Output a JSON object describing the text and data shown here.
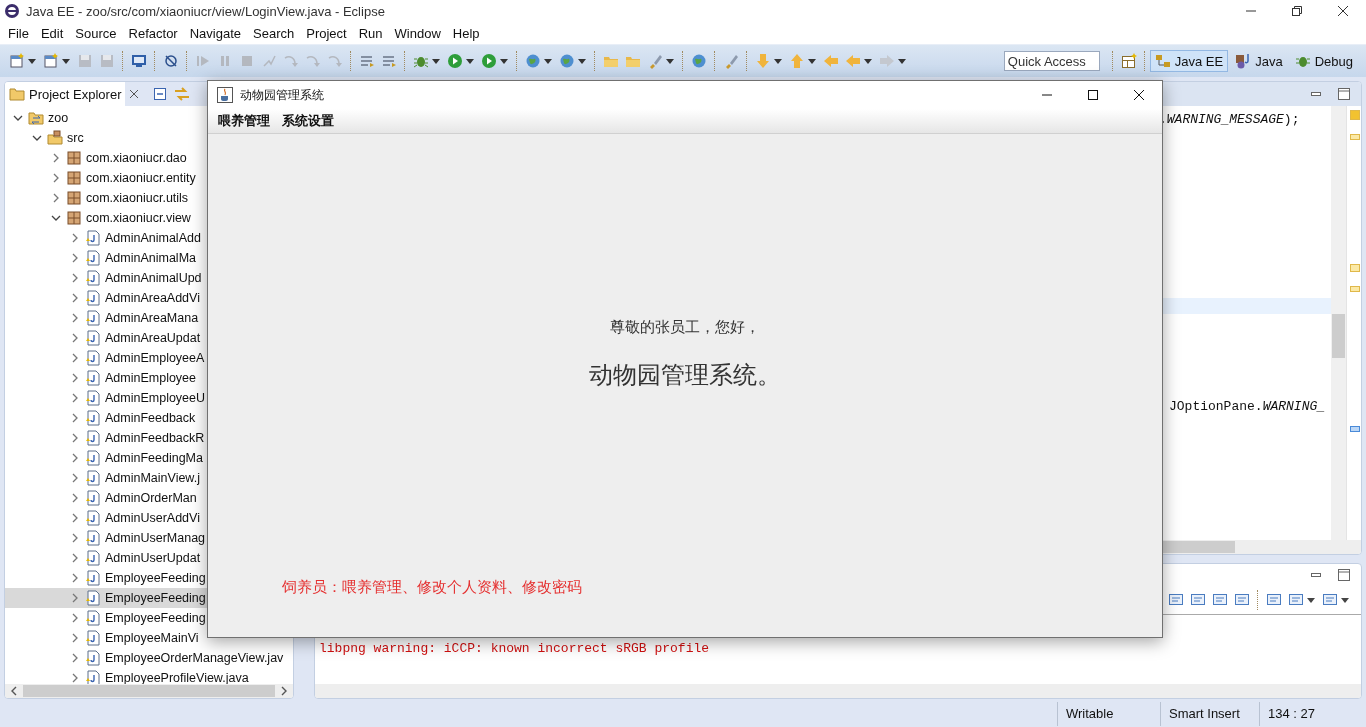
{
  "window": {
    "title": "Java EE - zoo/src/com/xiaoniucr/view/LoginView.java - Eclipse"
  },
  "menu": [
    "File",
    "Edit",
    "Source",
    "Refactor",
    "Navigate",
    "Search",
    "Project",
    "Run",
    "Window",
    "Help"
  ],
  "quick_access": {
    "placeholder": "Quick Access"
  },
  "perspectives": [
    {
      "label": "Java EE",
      "selected": true
    },
    {
      "label": "Java",
      "selected": false
    },
    {
      "label": "Debug",
      "selected": false
    }
  ],
  "project_explorer": {
    "title": "Project Explorer",
    "tree": [
      {
        "label": "zoo",
        "kind": "project",
        "expanded": true,
        "selected": false,
        "children": [
          {
            "label": "src",
            "kind": "source",
            "expanded": true,
            "selected": false,
            "children": [
              {
                "label": "com.xiaoniucr.dao",
                "kind": "package",
                "expanded": false,
                "selected": false
              },
              {
                "label": "com.xiaoniucr.entity",
                "kind": "package",
                "expanded": false,
                "selected": false
              },
              {
                "label": "com.xiaoniucr.utils",
                "kind": "package",
                "expanded": false,
                "selected": false
              },
              {
                "label": "com.xiaoniucr.view",
                "kind": "package",
                "expanded": true,
                "selected": false,
                "children": [
                  {
                    "label": "AdminAnimalAdd",
                    "kind": "file",
                    "expanded": false,
                    "selected": false
                  },
                  {
                    "label": "AdminAnimalMa",
                    "kind": "file",
                    "expanded": false,
                    "selected": false
                  },
                  {
                    "label": "AdminAnimalUpd",
                    "kind": "file",
                    "expanded": false,
                    "selected": false
                  },
                  {
                    "label": "AdminAreaAddVi",
                    "kind": "file",
                    "expanded": false,
                    "selected": false
                  },
                  {
                    "label": "AdminAreaMana",
                    "kind": "file",
                    "expanded": false,
                    "selected": false
                  },
                  {
                    "label": "AdminAreaUpdat",
                    "kind": "file",
                    "expanded": false,
                    "selected": false
                  },
                  {
                    "label": "AdminEmployeeA",
                    "kind": "file",
                    "expanded": false,
                    "selected": false
                  },
                  {
                    "label": "AdminEmployee",
                    "kind": "file",
                    "expanded": false,
                    "selected": false
                  },
                  {
                    "label": "AdminEmployeeU",
                    "kind": "file",
                    "expanded": false,
                    "selected": false
                  },
                  {
                    "label": "AdminFeedback",
                    "kind": "file",
                    "expanded": false,
                    "selected": false
                  },
                  {
                    "label": "AdminFeedbackR",
                    "kind": "file",
                    "expanded": false,
                    "selected": false
                  },
                  {
                    "label": "AdminFeedingMa",
                    "kind": "file",
                    "expanded": false,
                    "selected": false
                  },
                  {
                    "label": "AdminMainView.j",
                    "kind": "file",
                    "expanded": false,
                    "selected": false
                  },
                  {
                    "label": "AdminOrderMan",
                    "kind": "file",
                    "expanded": false,
                    "selected": false
                  },
                  {
                    "label": "AdminUserAddVi",
                    "kind": "file",
                    "expanded": false,
                    "selected": false
                  },
                  {
                    "label": "AdminUserManag",
                    "kind": "file",
                    "expanded": false,
                    "selected": false
                  },
                  {
                    "label": "AdminUserUpdat",
                    "kind": "file",
                    "expanded": false,
                    "selected": false
                  },
                  {
                    "label": "EmployeeFeeding",
                    "kind": "file",
                    "expanded": false,
                    "selected": false
                  },
                  {
                    "label": "EmployeeFeeding",
                    "kind": "file",
                    "expanded": false,
                    "selected": true
                  },
                  {
                    "label": "EmployeeFeeding",
                    "kind": "file",
                    "expanded": false,
                    "selected": false
                  },
                  {
                    "label": "EmployeeMainVi",
                    "kind": "file",
                    "expanded": false,
                    "selected": false
                  },
                  {
                    "label": "EmployeeOrderManageView.jav",
                    "kind": "file",
                    "expanded": false,
                    "selected": false
                  },
                  {
                    "label": "EmployeeProfileView.java",
                    "kind": "file",
                    "expanded": false,
                    "selected": false
                  }
                ]
              }
            ]
          }
        ]
      }
    ]
  },
  "editor": {
    "lines": [
      ".*WARNING_MESSAGE*);",
      "JOptionPane.*WARNING_*"
    ]
  },
  "console": {
    "lines": [
      "libpng warning: iCCP: known incorrect sRGB profile"
    ]
  },
  "status_bar": [
    "Writable",
    "Smart Insert",
    "134 : 27"
  ],
  "dialog": {
    "title": "动物园管理系统",
    "menu": [
      "喂养管理",
      "系统设置"
    ],
    "greeting": "尊敬的张员工，您好，",
    "heading": "动物园管理系统。",
    "roles": "饲养员：喂养管理、修改个人资料、修改密码"
  }
}
